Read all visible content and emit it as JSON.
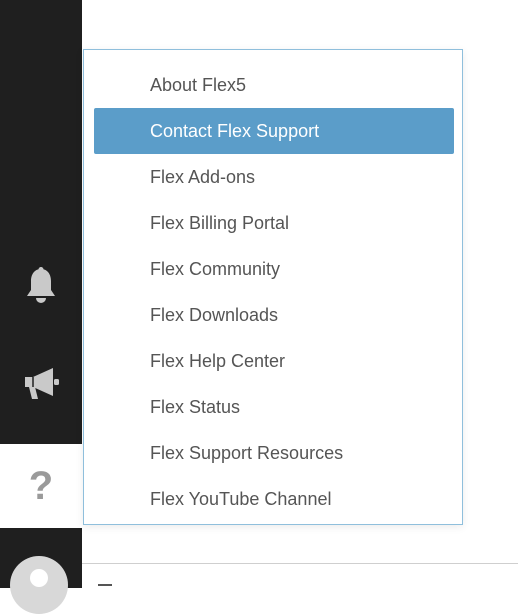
{
  "sidebar": {
    "icons": [
      "bell-icon",
      "megaphone-icon",
      "help-icon",
      "avatar"
    ],
    "help_glyph": "?"
  },
  "menu": {
    "items": [
      {
        "label": "About Flex5"
      },
      {
        "label": "Contact Flex Support",
        "active": true
      },
      {
        "label": "Flex Add-ons"
      },
      {
        "label": "Flex Billing Portal"
      },
      {
        "label": "Flex Community"
      },
      {
        "label": "Flex Downloads"
      },
      {
        "label": "Flex Help Center"
      },
      {
        "label": "Flex Status"
      },
      {
        "label": "Flex Support Resources"
      },
      {
        "label": "Flex YouTube Channel"
      }
    ],
    "active_color": "#5b9dc9"
  }
}
